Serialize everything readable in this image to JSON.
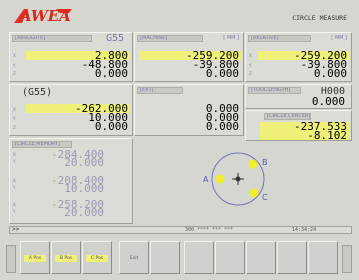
{
  "brand": {
    "logo_text": "AWEA"
  },
  "screen_title": "CIRCLE MEASURE",
  "panel_top_left": {
    "header": "[ABSOLUTE]",
    "code": "G55",
    "values": [
      "2.800",
      "-48.800",
      "0.000"
    ]
  },
  "panel_top_mid": {
    "header": "[MACHINE]",
    "unit": "[ MM ]",
    "values": [
      "-259.200",
      "-39.800",
      "0.000"
    ]
  },
  "panel_top_right": {
    "header": "[RELATIVE]",
    "unit": "[ MM ]",
    "values": [
      "-259.200",
      "-39.800",
      "0.000"
    ]
  },
  "panel_mid_left": {
    "code": "(G55)",
    "values": [
      "-262.000",
      "10.000",
      "0.000"
    ]
  },
  "panel_mid_center": {
    "header": "[EXT]",
    "values": [
      "0.000",
      "0.000",
      "0.000"
    ]
  },
  "panel_tool_length": {
    "header": "[TOOL LENGTH]",
    "value": "H000",
    "value2": "0.000"
  },
  "panel_circle_center": {
    "header": "[CIRCLE CENTER]",
    "values": [
      "-237.533",
      "-8.102"
    ]
  },
  "panel_circle_memory": {
    "header": "[CIRCLE MEMORY]",
    "values": [
      "-284.400",
      "20.000",
      "-208.400",
      "10.000",
      "-258.200",
      "20.000"
    ]
  },
  "diagram": {
    "points": [
      "A",
      "B",
      "C"
    ]
  },
  "status_bar": {
    "prompt": ">>",
    "program": "300 **** *** ***",
    "time": "14:34:24"
  },
  "softkeys": [
    "A Pos",
    "B Pos",
    "C Pos",
    "Exit",
    "",
    "",
    "",
    "",
    "",
    "",
    ""
  ]
}
